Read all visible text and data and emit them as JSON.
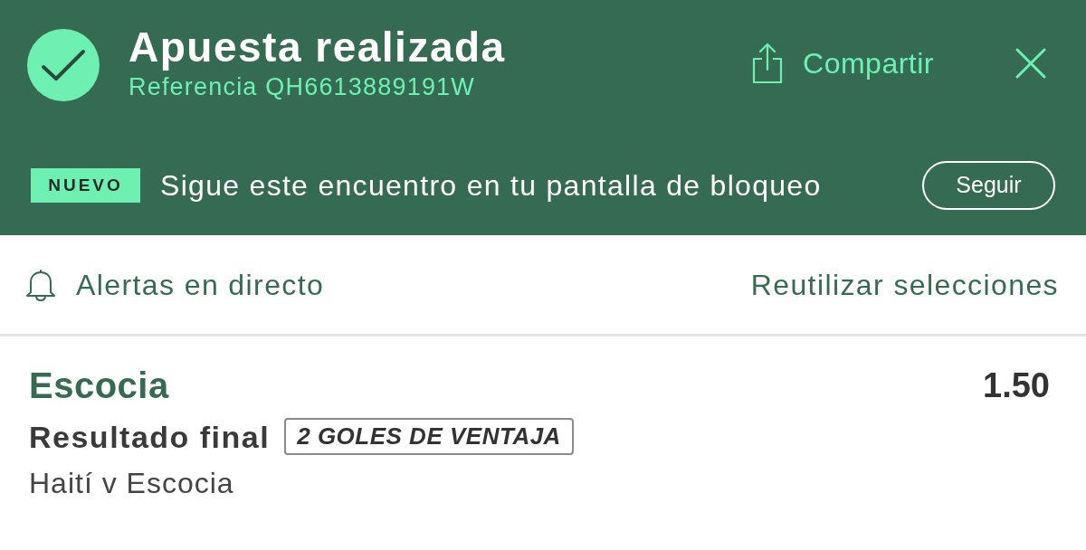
{
  "header": {
    "title": "Apuesta realizada",
    "reference": "Referencia QH6613889191W",
    "share_button": "Compartir"
  },
  "promo": {
    "badge": "NUEVO",
    "message": "Sigue este encuentro en tu pantalla de bloqueo",
    "button": "Seguir"
  },
  "actions": {
    "alerts": "Alertas en directo",
    "reuse": "Reutilizar selecciones"
  },
  "selection": {
    "name": "Escocia",
    "odds": "1.50",
    "market": "Resultado final",
    "tag": "2 GOLES DE VENTAJA",
    "event": "Haití v Escocia"
  }
}
